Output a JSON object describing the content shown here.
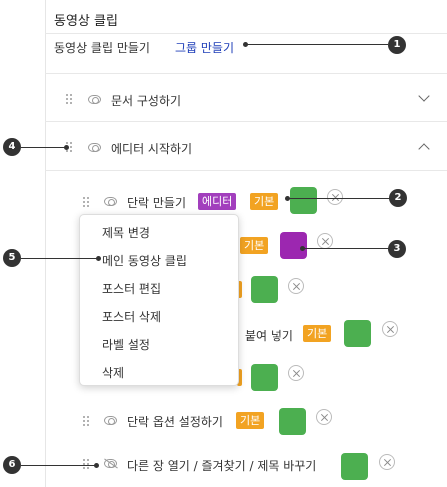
{
  "header": {
    "title": "동영상 클립"
  },
  "sub": {
    "label": "동영상 클립 만들기",
    "link": "그룹 만들기"
  },
  "sections": [
    {
      "title": "문서 구성하기",
      "expanded": false
    },
    {
      "title": "에디터 시작하기",
      "expanded": true
    }
  ],
  "items": [
    {
      "label": "단락 만들기",
      "badges": [
        "에디터",
        "기본"
      ],
      "swatch": "#4caf50"
    },
    {
      "label": "",
      "badges": [
        "기본"
      ],
      "swatch": "#9c27b0"
    },
    {
      "label": "",
      "badges": [],
      "swatch": "#4caf50"
    },
    {
      "label": "붙여 넣기",
      "badges": [
        "기본"
      ],
      "swatch": "#4caf50"
    },
    {
      "label": "",
      "badges": [],
      "swatch": "#4caf50"
    },
    {
      "label": "단락 옵션 설정하기",
      "badges": [
        "기본"
      ],
      "swatch": "#4caf50"
    },
    {
      "label": "다른 장 열기 / 즐겨찾기 / 제목 바꾸기",
      "badges": [],
      "swatch": "#4caf50"
    }
  ],
  "context_menu": [
    "제목 변경",
    "메인 동영상 클립",
    "포스터 편집",
    "포스터 삭제",
    "라벨 설정",
    "삭제"
  ],
  "callouts": [
    "1",
    "2",
    "3",
    "4",
    "5",
    "6"
  ],
  "colors": {
    "editor_badge": "#a23fbd",
    "basic_badge": "#f2a322",
    "green": "#4caf50",
    "purple": "#9c27b0",
    "link": "#1f3fb8"
  }
}
